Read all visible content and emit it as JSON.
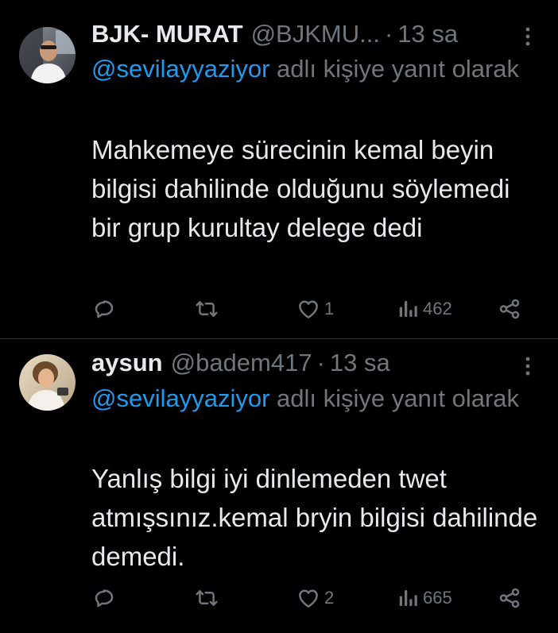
{
  "theme": {
    "background": "#000000",
    "text_primary": "#e7e9ea",
    "text_secondary": "#71767b",
    "link": "#1d9bf0",
    "divider": "#2f3336"
  },
  "tweets": [
    {
      "display_name": "BJK- MURAT",
      "handle": "@BJKMU...",
      "separator": "·",
      "time": "13 sa",
      "reply_to_handle": "@sevilayyaziyor",
      "reply_suffix": "adlı kişiye yanıt olarak",
      "body": "Mahkemeye sürecinin kemal beyin bilgisi dahilinde olduğunu söylemedi bir grup kurultay delege dedi",
      "replies": "",
      "retweets": "",
      "likes": "1",
      "views": "462",
      "icons": [
        "more-icon",
        "reply-icon",
        "retweet-icon",
        "like-icon",
        "views-icon",
        "share-icon"
      ]
    },
    {
      "display_name": "aysun",
      "handle": "@badem417",
      "separator": "·",
      "time": "13 sa",
      "reply_to_handle": "@sevilayyaziyor",
      "reply_suffix": "adlı kişiye yanıt olarak",
      "body": "Yanlış bilgi iyi dinlemeden twet atmışsınız.kemal bryin bilgisi dahilinde demedi.",
      "replies": "",
      "retweets": "",
      "likes": "2",
      "views": "665",
      "icons": [
        "more-icon",
        "reply-icon",
        "retweet-icon",
        "like-icon",
        "views-icon",
        "share-icon"
      ]
    }
  ]
}
